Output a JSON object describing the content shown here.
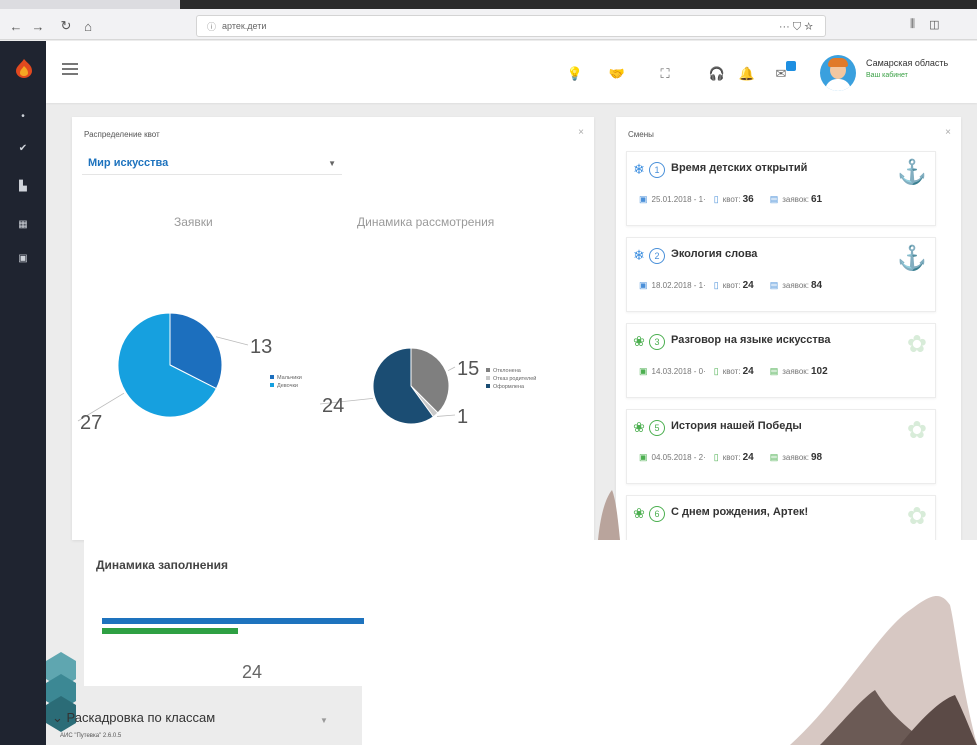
{
  "browser": {
    "url": "артек.дети",
    "tools": "··· ⛉ ☆"
  },
  "header": {
    "user_name": "Самарская область",
    "user_status": "Ваш кабинет"
  },
  "quota_panel": {
    "title": "Распределение квот",
    "select_value": "Мир искусства",
    "chart_titles": [
      "Заявки",
      "Динамика рассмотрения"
    ]
  },
  "chart_data": [
    {
      "type": "pie",
      "title": "Заявки",
      "categories": [
        "Мальчики",
        "Девочки"
      ],
      "values": [
        13,
        27
      ],
      "colors": [
        "#1c6fbe",
        "#16a0df"
      ],
      "legend": "right"
    },
    {
      "type": "pie",
      "title": "Динамика рассмотрения",
      "categories": [
        "Отклонена",
        "Отказ родителей",
        "Оформлена"
      ],
      "values": [
        15,
        1,
        24
      ],
      "colors": [
        "#7f7f7f",
        "#c9c9c9",
        "#1b4d73"
      ],
      "legend": "right"
    }
  ],
  "shifts_panel": {
    "title": "Смены",
    "quota_label": "квот:",
    "apps_label": "заявок:",
    "items": [
      {
        "num": "1",
        "name": "Время детских открытий",
        "date": "25.01.2018 - 1·",
        "quota": "36",
        "apps": "61",
        "color": "blue"
      },
      {
        "num": "2",
        "name": "Экология слова",
        "date": "18.02.2018 - 1·",
        "quota": "24",
        "apps": "84",
        "color": "blue"
      },
      {
        "num": "3",
        "name": "Разговор на языке искусства",
        "date": "14.03.2018 - 0·",
        "quota": "24",
        "apps": "102",
        "color": "green"
      },
      {
        "num": "5",
        "name": "История нашей Победы",
        "date": "04.05.2018 - 2·",
        "quota": "24",
        "apps": "98",
        "color": "green"
      },
      {
        "num": "6",
        "name": "С днем рождения, Артек!",
        "date": "",
        "quota": "",
        "apps": "",
        "color": "green"
      }
    ]
  },
  "fill_panel": {
    "title": "Динамика заполнения",
    "value": "24"
  },
  "distribution_title": "Раскадровка по классам",
  "version": "АИС \"Путевка\" 2.6.0.5"
}
